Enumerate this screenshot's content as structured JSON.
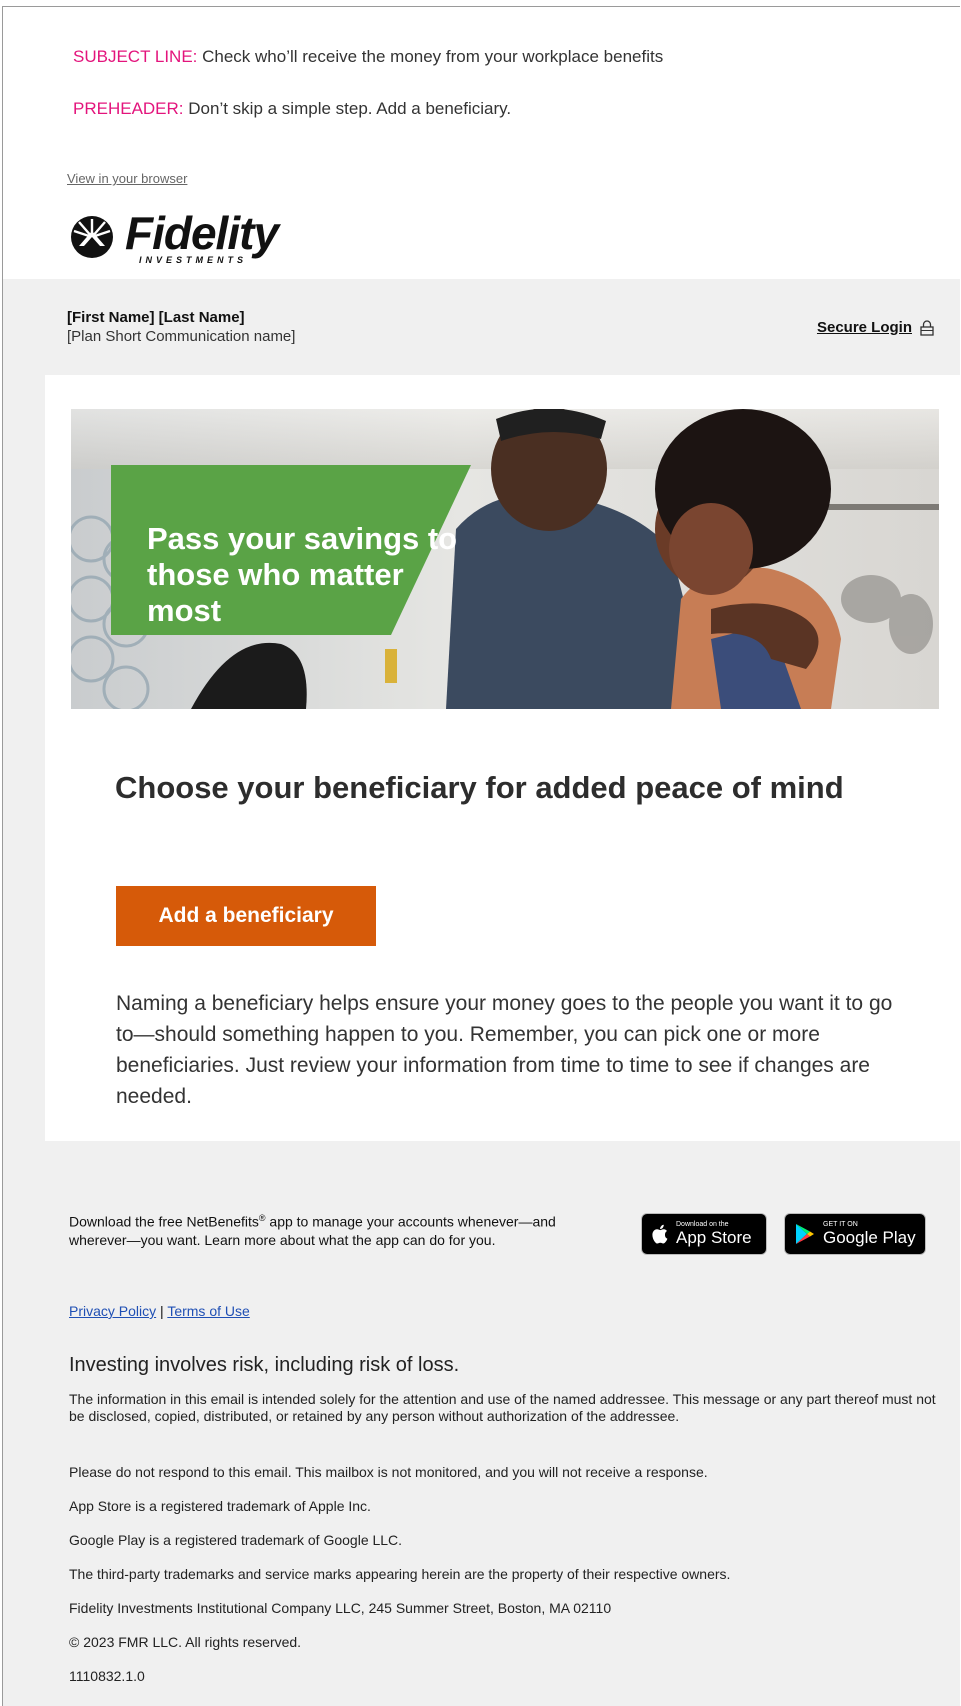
{
  "header": {
    "subject_label": "SUBJECT LINE:",
    "subject_text": "Check who’ll receive the money from your workplace benefits",
    "preheader_label": "PREHEADER:",
    "preheader_text": "Don’t skip a simple step. Add a beneficiary.",
    "view_link": "View in your browser"
  },
  "logo": {
    "wordmark": "Fidelity",
    "subline": "INVESTMENTS"
  },
  "account": {
    "name": "[First Name] [Last Name]",
    "plan": "[Plan Short Communication name]",
    "login_label": "Secure Login",
    "login_icon": "lock-icon"
  },
  "hero": {
    "text": "Pass your savings to those who matter most"
  },
  "main": {
    "headline": "Choose your beneficiary for added peace of mind",
    "cta_label": "Add a beneficiary",
    "body": "Naming a beneficiary helps ensure your money goes to the people you want it to go to—should something happen to you. Remember, you can pick one or more beneficiaries. Just review your information from time to time to see if changes are needed."
  },
  "footer": {
    "app_text_before": "Download the free NetBenefits",
    "app_text_after": " app to manage your accounts whenever—and wherever—you want. Learn more about what the app can do for you.",
    "reg_mark": "®",
    "app_store": {
      "small": "Download on the",
      "big": "App Store",
      "icon": "apple-icon"
    },
    "google_play": {
      "small": "GET IT ON",
      "big": "Google Play",
      "icon": "play-icon"
    },
    "privacy": "Privacy Policy",
    "separator": "|",
    "terms": "Terms of Use",
    "risk": "Investing involves risk, including risk of loss.",
    "fine": [
      "The information in this email is intended solely for the attention and use of the named addressee. This message or any part thereof must not be disclosed, copied, distributed, or retained by any person without authorization of the addressee.",
      "Please do not respond to this email. This mailbox is not monitored, and you will not receive a response.",
      "App Store is a registered trademark of Apple Inc.",
      "Google Play is a registered trademark of Google LLC.",
      "The third-party trademarks and service marks appearing herein are the property of their respective owners.",
      "Fidelity Investments Institutional Company LLC, 245 Summer Street, Boston, MA 02110",
      "© 2023 FMR LLC. All rights reserved.",
      "1110832.1.0"
    ]
  },
  "colors": {
    "accent_pink": "#e3147c",
    "cta_orange": "#d65a09",
    "hero_green": "#5aa346",
    "link_blue": "#1f4fb4"
  }
}
